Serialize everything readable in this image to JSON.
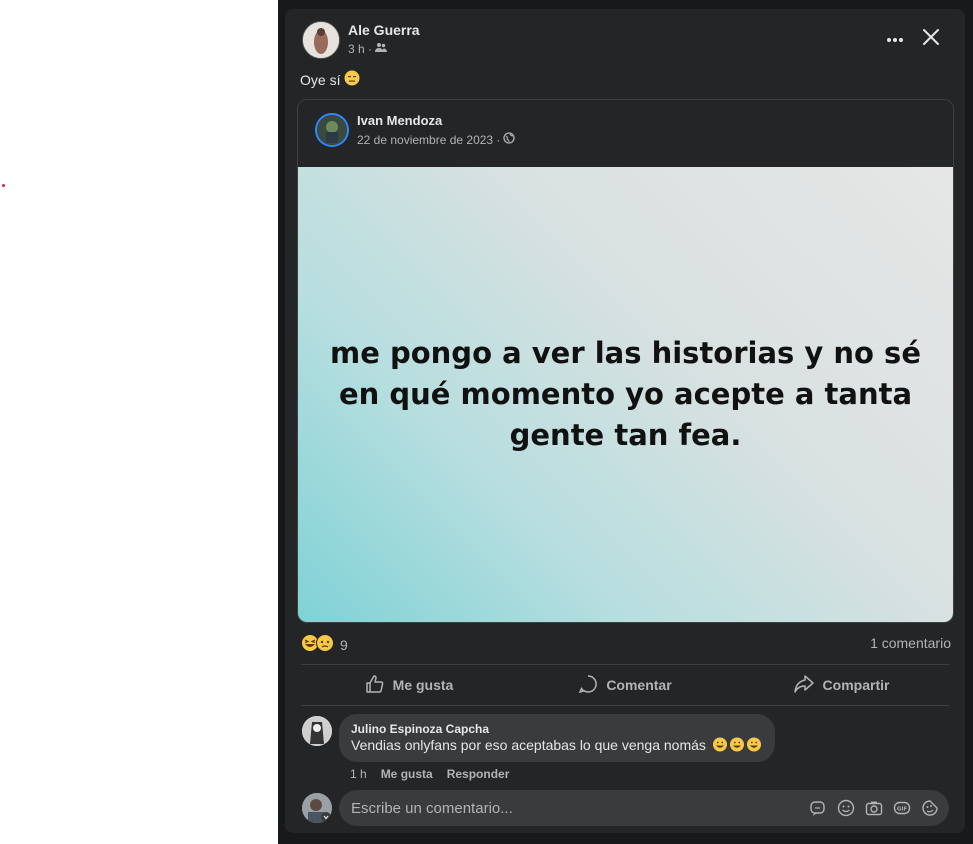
{
  "post": {
    "author": "Ale Guerra",
    "time": "3 h ·",
    "caption": "Oye sí",
    "shared": {
      "author": "Ivan Mendoza",
      "date": "22 de noviembre de 2023 ·",
      "quote": "me pongo a ver las historias y no sé en qué momento yo acepte a tanta gente tan fea."
    },
    "reaction_count": "9",
    "comment_count": "1 comentario",
    "actions": {
      "like": "Me gusta",
      "comment": "Comentar",
      "share": "Compartir"
    }
  },
  "comment": {
    "author": "Julino Espinoza Capcha",
    "text": "Vendias onlyfans por eso aceptabas lo que venga nomás",
    "time": "1 h",
    "like": "Me gusta",
    "reply": "Responder"
  },
  "composer": {
    "placeholder": "Escribe un comentario..."
  },
  "icons": {
    "audience": "friends-icon",
    "public": "globe-icon",
    "more": "more-icon",
    "close": "close-icon",
    "like": "thumbs-up-icon",
    "comment": "comment-icon",
    "share": "share-icon",
    "composer": [
      "sticker-comment-icon",
      "emoji-icon",
      "camera-icon",
      "gif-icon",
      "sticker-icon"
    ]
  },
  "colors": {
    "background": "#242526",
    "text": "#e4e6eb",
    "secondary": "#b0b3b8",
    "accent": "#1877f2"
  }
}
